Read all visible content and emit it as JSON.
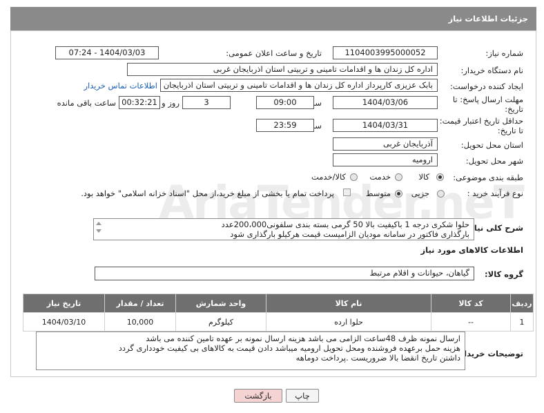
{
  "panel_title": "جزئیات اطلاعات نیاز",
  "fields": {
    "need_number_label": "شماره نیاز:",
    "need_number": "1104003995000052",
    "announce_label": "تاریخ و ساعت اعلان عمومی:",
    "announce_value": "1404/03/03 - 07:24",
    "buyer_org_label": "نام دستگاه خریدار:",
    "buyer_org": "اداره کل زندان ها و اقدامات تامینی و تربیتی استان اذربایجان غربی",
    "requester_label": "ایجاد کننده درخواست:",
    "requester": "بابک عزیزی کارپرداز اداره کل زندان ها و اقدامات تامینی و تربیتی استان اذربایجان",
    "contact_link": "اطلاعات تماس خریدار",
    "deadline_label_1": "مهلت ارسال پاسخ: تا",
    "deadline_label_2": "تاریخ:",
    "deadline_date": "1404/03/06",
    "time_label": "ساعت",
    "deadline_time": "09:00",
    "days_value": "3",
    "days_label": "روز و",
    "remaining_time": "00:32:21",
    "remaining_label": "ساعت باقی مانده",
    "validity_label_1": "حداقل تاریخ اعتبار قیمت:",
    "validity_label_2": "تا تاریخ:",
    "validity_date": "1404/03/31",
    "validity_time": "23:59",
    "province_label": "استان محل تحویل:",
    "province": "آذربایجان غربی",
    "city_label": "شهر محل تحویل:",
    "city": "ارومیه",
    "category_label": "طبقه بندی موضوعی:",
    "category_options": [
      "کالا",
      "خدمت",
      "کالا/خدمت"
    ],
    "category_selected": "کالا",
    "process_label": "نوع فرآیند خرید :",
    "process_options": [
      "جزیی",
      "متوسط"
    ],
    "process_selected": "متوسط",
    "payment_note": "پرداخت تمام یا بخشی از مبلغ خرید،از محل \"اسناد خزانه اسلامی\" خواهد بود."
  },
  "description": {
    "label": "شرح کلی نیاز:",
    "line1": "حلوا شکری درجه 1 باکیفیت بالا  50 گرمی بسته بندی  سلفونی200،000عدد",
    "line2": "بارگذاری فاکتور در سامانه مودیان الزامیست قیمت هرکیلو بارگذاری شود"
  },
  "goods_section_title": "اطلاعات کالاهای مورد نیاز",
  "goods_group_label": "گروه کالا:",
  "goods_group": "گیاهان، حیوانات و اقلام مرتبط",
  "table": {
    "headers": [
      "ردیف",
      "کد کالا",
      "نام کالا",
      "واحد شمارش",
      "تعداد / مقدار",
      "تاریخ نیاز"
    ],
    "rows": [
      [
        "1",
        "--",
        "حلوا ارده",
        "کیلوگرم",
        "10,000",
        "1404/03/10"
      ]
    ]
  },
  "buyer_notes": {
    "label": "توضیحات خریدار:",
    "line1": "ارسال نمونه ظرف 48ساعت الزامی می باشد هزینه ارسال نمونه بر عهده تامین کننده می باشد",
    "line2": "هزینه حمل برعهده فروشنده ومحل تحویل ارومیه میباشد دادن قیمت به کالاهای بی کیفیت خودداری گردد",
    "line3": "داشتن تاریخ انقضا بالا ضروریست .پرداخت دوماهه"
  },
  "buttons": {
    "print": "چاپ",
    "back": "بازگشت"
  },
  "colors": {
    "header_bg": "#8a8a8a",
    "table_header_bg": "#6f6f6f",
    "back_button_bg": "#f6d3d3",
    "link": "#1a5fb4"
  }
}
